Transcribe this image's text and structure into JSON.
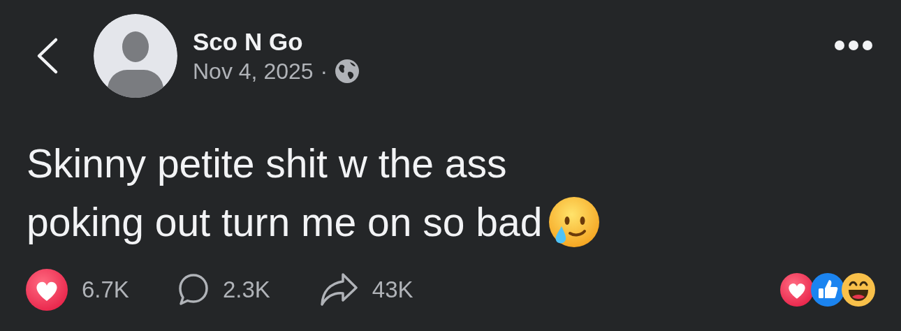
{
  "author": {
    "name": "Sco N Go",
    "date": "Nov 4, 2025",
    "separator": "·"
  },
  "post": {
    "lines": [
      "Skinny petite shit w the ass",
      "poking out turn me on so bad"
    ]
  },
  "stats": [
    {
      "kind": "likes",
      "count": "6.7K"
    },
    {
      "kind": "comments",
      "count": "2.3K"
    },
    {
      "kind": "shares",
      "count": "43K"
    }
  ]
}
